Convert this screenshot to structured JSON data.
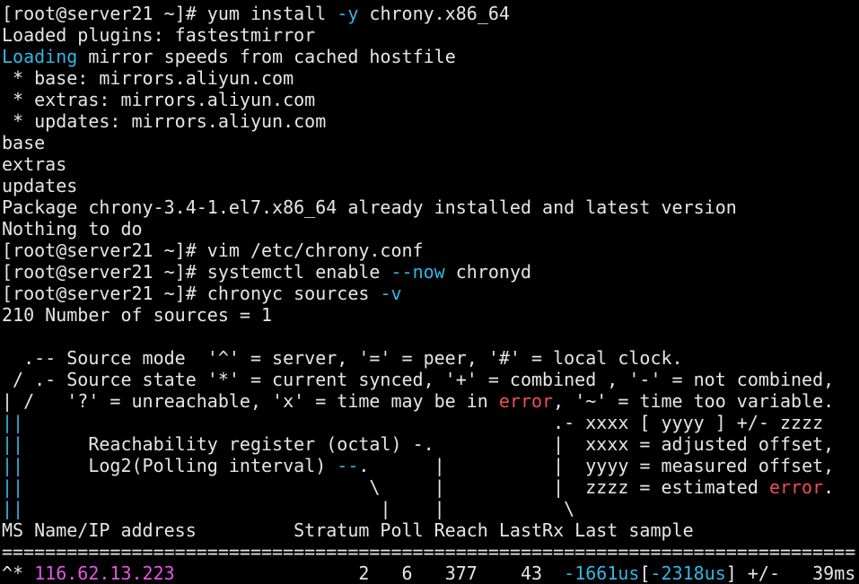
{
  "terminal": {
    "colors": {
      "background": "#000000",
      "foreground": "#e6e6e6",
      "option_highlight": "#33b6e6",
      "error_word": "#ef4f4f",
      "ip_address": "#e356e3"
    },
    "lines": [
      [
        {
          "t": "[root@server21 ~]# yum install "
        },
        {
          "t": "-y",
          "c": "hl"
        },
        {
          "t": " chrony.x86_64"
        }
      ],
      [
        {
          "t": "Loaded plugins: fastestmirror"
        }
      ],
      [
        {
          "t": "Loading",
          "c": "hl"
        },
        {
          "t": " mirror speeds from cached hostfile"
        }
      ],
      [
        {
          "t": " * base: mirrors.aliyun.com"
        }
      ],
      [
        {
          "t": " * extras: mirrors.aliyun.com"
        }
      ],
      [
        {
          "t": " * updates: mirrors.aliyun.com"
        }
      ],
      [
        {
          "t": "base"
        }
      ],
      [
        {
          "t": "extras"
        }
      ],
      [
        {
          "t": "updates"
        }
      ],
      [
        {
          "t": "Package chrony-3.4-1.el7.x86_64 already installed and latest version"
        }
      ],
      [
        {
          "t": "Nothing to do"
        }
      ],
      [
        {
          "t": "[root@server21 ~]# vim /etc/chrony.conf"
        }
      ],
      [
        {
          "t": "[root@server21 ~]# systemctl enable "
        },
        {
          "t": "--now",
          "c": "hl"
        },
        {
          "t": " chronyd"
        }
      ],
      [
        {
          "t": "[root@server21 ~]# chronyc sources "
        },
        {
          "t": "-v",
          "c": "hl"
        }
      ],
      [
        {
          "t": "210 Number of sources = 1"
        }
      ],
      [
        {
          "t": ""
        }
      ],
      [
        {
          "t": "  .-- Source mode  '^' = server, '=' = peer, '#' = local clock."
        }
      ],
      [
        {
          "t": " / .- Source state '*' = current synced, '+' = combined , '-' = not combined,"
        }
      ],
      [
        {
          "t": "| /   '?' = unreachable, 'x' = time may be in "
        },
        {
          "t": "error",
          "c": "err"
        },
        {
          "t": ", '~' = time too variable."
        }
      ],
      [
        {
          "t": "||",
          "c": "hl"
        },
        {
          "t": "                                                 .- xxxx [ yyyy ] +/- zzzz"
        }
      ],
      [
        {
          "t": "||",
          "c": "hl"
        },
        {
          "t": "      Reachability register (octal) -.           |  xxxx = adjusted offset,"
        }
      ],
      [
        {
          "t": "||",
          "c": "hl"
        },
        {
          "t": "      Log2(Polling interval) "
        },
        {
          "t": "--",
          "c": "hl"
        },
        {
          "t": ".      |          |  yyyy = measured offset,"
        }
      ],
      [
        {
          "t": "||",
          "c": "hl"
        },
        {
          "t": "                                \\     |          |  zzzz = estimated "
        },
        {
          "t": "error",
          "c": "err"
        },
        {
          "t": "."
        }
      ],
      [
        {
          "t": "||",
          "c": "hl"
        },
        {
          "t": "                                 |    |           \\"
        }
      ],
      [
        {
          "t": "MS Name/IP address         Stratum Poll Reach LastRx Last sample"
        }
      ],
      [
        {
          "t": "==============================================================================="
        }
      ],
      [
        {
          "t": "^* "
        },
        {
          "t": "116.62.13.223",
          "c": "ip"
        },
        {
          "t": "                 2   6   377    43  "
        },
        {
          "t": "-1661us",
          "c": "hl"
        },
        {
          "t": "["
        },
        {
          "t": "-2318us",
          "c": "hl"
        },
        {
          "t": "] +/-   39ms"
        }
      ]
    ],
    "line_names": [
      "command-yum-install",
      "output-loaded-plugins",
      "output-loading-mirrors",
      "output-mirror-base",
      "output-mirror-extras",
      "output-mirror-updates",
      "output-repo-base",
      "output-repo-extras",
      "output-repo-updates",
      "output-package-installed",
      "output-nothing-to-do",
      "command-vim-chrony-conf",
      "command-systemctl-enable",
      "command-chronyc-sources",
      "output-number-of-sources",
      "blank-line",
      "legend-source-mode",
      "legend-source-state",
      "legend-state-unreachable",
      "legend-sample-format",
      "legend-reachability",
      "legend-polling-interval",
      "legend-estimated-error",
      "legend-pointer-lines",
      "sources-table-header",
      "sources-table-separator",
      "sources-table-row"
    ]
  }
}
